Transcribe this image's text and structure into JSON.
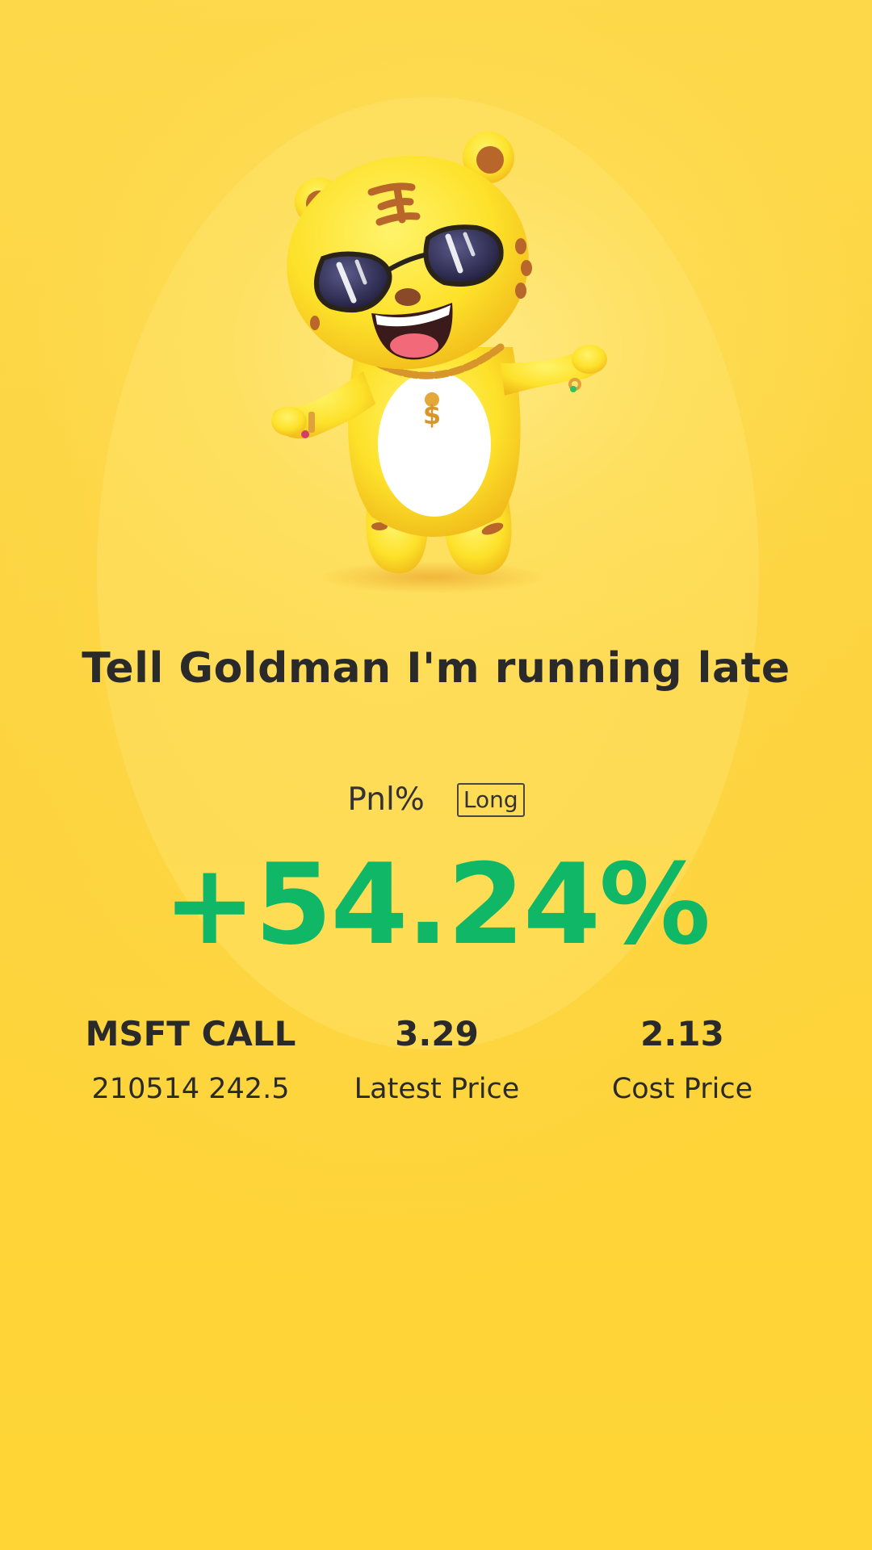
{
  "headline": "Tell Goldman I'm running late",
  "pnl": {
    "label": "Pnl%",
    "badge": "Long",
    "value": "+54.24%"
  },
  "stats": {
    "contract": {
      "name": "MSFT CALL",
      "detail": "210514 242.5"
    },
    "latest": {
      "value": "3.29",
      "label": "Latest Price"
    },
    "cost": {
      "value": "2.13",
      "label": "Cost Price"
    }
  },
  "colors": {
    "background": "#fcd236",
    "gain": "#10b767",
    "text": "#2b2a2a"
  },
  "mascot": {
    "icon": "sunglasses-tiger-mascot-icon"
  }
}
